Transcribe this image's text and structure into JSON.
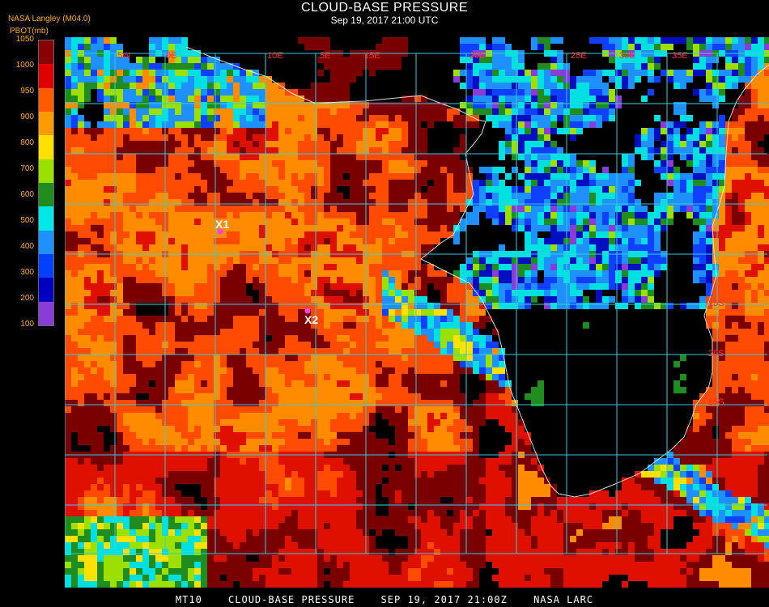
{
  "header": {
    "title": "CLOUD-BASE PRESSURE",
    "subtitle": "Sep 19, 2017 21:00 UTC",
    "provider": "NASA Langley (M04.0)",
    "legend_title": "PBOT(mb)"
  },
  "legend": {
    "ticks": [
      "1050",
      "1000",
      "950",
      "900",
      "800",
      "700",
      "600",
      "500",
      "400",
      "300",
      "200",
      "100"
    ],
    "colors": [
      "#8b0000",
      "#e00000",
      "#ff5a00",
      "#ff9a00",
      "#ffe000",
      "#9be000",
      "#1e8c1e",
      "#00e8e8",
      "#1e90ff",
      "#0040ff",
      "#0000c0",
      "#8a3cd8"
    ]
  },
  "map": {
    "longitude_labels": [
      "5W",
      "0E",
      "10E",
      "5E",
      "15E",
      "20E",
      "25E",
      "30E",
      "35E"
    ],
    "latitude_labels": [
      "15S",
      "20S",
      "25S"
    ],
    "markers": [
      {
        "label": "X1",
        "color": "#ff40ff"
      },
      {
        "label": "X2",
        "color": "#ff40ff"
      }
    ],
    "colors": {
      "grid": "#33cfd6",
      "coast": "#ffffff",
      "grid_label": "#ff3030",
      "ocean": "#000000"
    }
  },
  "footer": {
    "parts": [
      "MT10",
      "CLOUD-BASE PRESSURE",
      "SEP 19, 2017 21:00Z",
      "NASA LARC"
    ]
  }
}
